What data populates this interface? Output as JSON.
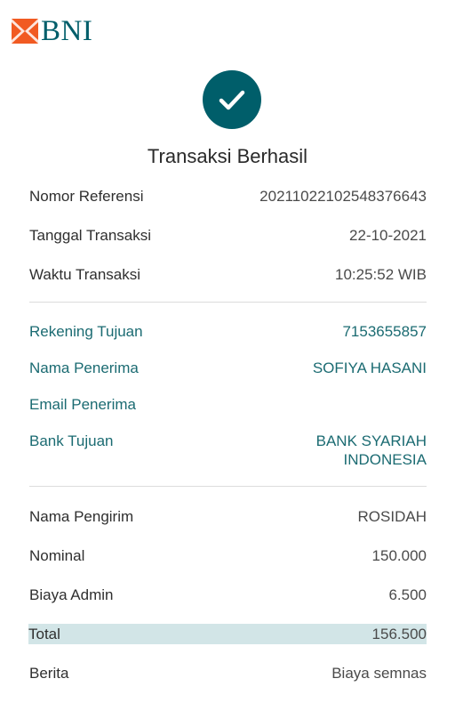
{
  "logo": {
    "text": "BNI",
    "mark_color": "#f15a22",
    "text_color": "#005e6a"
  },
  "status": {
    "icon": "checkmark-icon",
    "circle_color": "#005e6a",
    "title": "Transaksi Berhasil"
  },
  "transaction": {
    "reference_label": "Nomor Referensi",
    "reference_value": "20211022102548376643",
    "date_label": "Tanggal Transaksi",
    "date_value": "22-10-2021",
    "time_label": "Waktu Transaksi",
    "time_value": "10:25:52 WIB"
  },
  "recipient": {
    "accent_color": "#1b6b72",
    "account_label": "Rekening Tujuan",
    "account_value": "7153655857",
    "name_label": "Nama Penerima",
    "name_value": "SOFIYA HASANI",
    "email_label": "Email Penerima",
    "email_value": "",
    "bank_label": "Bank Tujuan",
    "bank_value_line1": "BANK SYARIAH",
    "bank_value_line2": "INDONESIA"
  },
  "payment": {
    "sender_label": "Nama Pengirim",
    "sender_value": "ROSIDAH",
    "nominal_label": "Nominal",
    "nominal_value": "150.000",
    "fee_label": "Biaya Admin",
    "fee_value": "6.500",
    "total_label": "Total",
    "total_value": "156.500",
    "total_highlight_color": "#d2e5e7",
    "note_label": "Berita",
    "note_value": "Biaya semnas"
  }
}
